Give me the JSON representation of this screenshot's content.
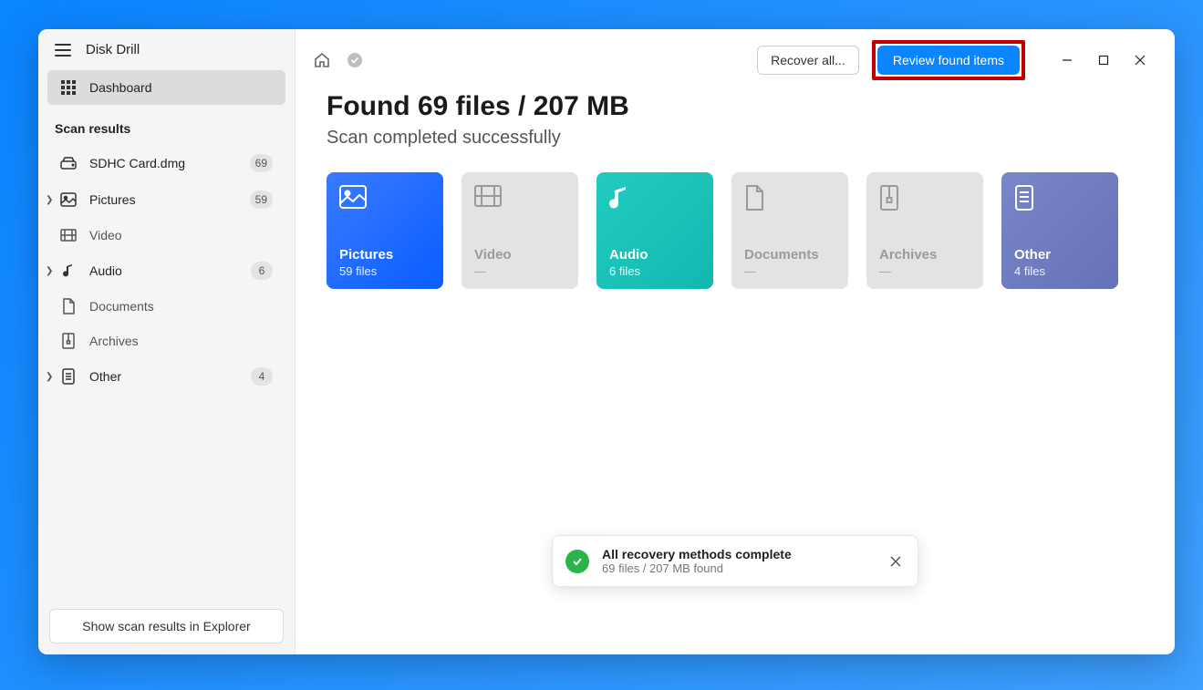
{
  "app": {
    "title": "Disk Drill"
  },
  "sidebar": {
    "dashboard_label": "Dashboard",
    "section_label": "Scan results",
    "items": [
      {
        "label": "SDHC Card.dmg",
        "count": "69",
        "icon": "drive-icon",
        "expandable": false
      },
      {
        "label": "Pictures",
        "count": "59",
        "icon": "image-icon",
        "expandable": true
      },
      {
        "label": "Video",
        "count": "",
        "icon": "video-icon",
        "expandable": false
      },
      {
        "label": "Audio",
        "count": "6",
        "icon": "music-icon",
        "expandable": true
      },
      {
        "label": "Documents",
        "count": "",
        "icon": "document-icon",
        "expandable": false
      },
      {
        "label": "Archives",
        "count": "",
        "icon": "archive-icon",
        "expandable": false
      },
      {
        "label": "Other",
        "count": "4",
        "icon": "other-icon",
        "expandable": true
      }
    ],
    "explorer_button": "Show scan results in Explorer"
  },
  "topbar": {
    "recover_all": "Recover all...",
    "review_items": "Review found items"
  },
  "results": {
    "headline": "Found 69 files / 207 MB",
    "subline": "Scan completed successfully",
    "cards": [
      {
        "title": "Pictures",
        "sub": "59 files",
        "variant": "pictures"
      },
      {
        "title": "Video",
        "sub": "—",
        "variant": "muted"
      },
      {
        "title": "Audio",
        "sub": "6 files",
        "variant": "audio"
      },
      {
        "title": "Documents",
        "sub": "—",
        "variant": "muted"
      },
      {
        "title": "Archives",
        "sub": "—",
        "variant": "muted"
      },
      {
        "title": "Other",
        "sub": "4 files",
        "variant": "other"
      }
    ]
  },
  "toast": {
    "title": "All recovery methods complete",
    "sub": "69 files / 207 MB found"
  }
}
